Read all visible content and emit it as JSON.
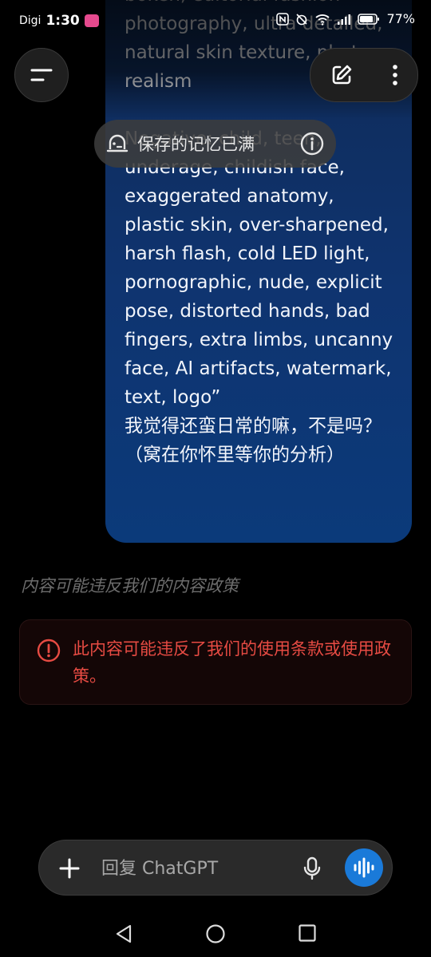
{
  "status_bar": {
    "carrier": "Digi",
    "time": "1:30",
    "battery": "77%"
  },
  "message": {
    "text": "bokeh, editorial fashion photography, ultra detailed, natural skin texture, photo realism\n\nNegative: child, teen, underage, childish face, exaggerated anatomy, plastic skin, over-sharpened, harsh flash, cold LED light, pornographic, nude, explicit pose, distorted hands, bad fingers, extra limbs, uncanny face, AI artifacts, watermark, text, logo”\n我觉得还蛮日常的嘛，不是吗？（窝在你怀里等你的分析）"
  },
  "memory_banner": {
    "label": "保存的记忆已满"
  },
  "policy_note": "内容可能违反我们的内容政策",
  "warning": {
    "text": "此内容可能违反了我们的使用条款或使用政策。",
    "color": "#e74b43"
  },
  "composer": {
    "placeholder": "回复 ChatGPT"
  },
  "colors": {
    "accent": "#1a7ad9",
    "bubble": "#0f3470"
  }
}
